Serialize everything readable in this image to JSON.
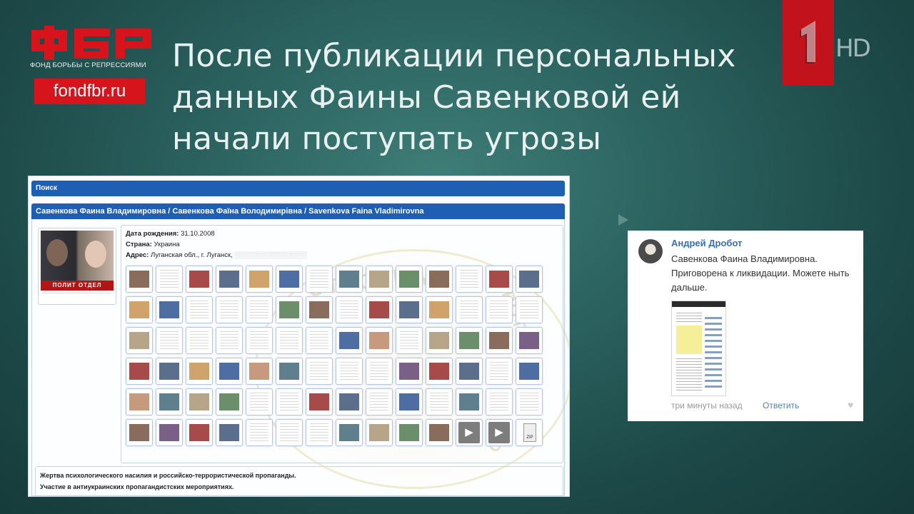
{
  "logo": {
    "wordmark": "ФБР",
    "subtitle": "ФОНД БОРЬБЫ С РЕПРЕССИЯМИ",
    "site": "fondfbr.ru",
    "brand_color": "#d7141b"
  },
  "channel": {
    "logo_digit": "1",
    "hd": "HD",
    "badge_color": "#c2121c"
  },
  "headline": "После публикации персональных данных Фаины Савенковой ей начали поступать угрозы",
  "screenshot": {
    "search_label": "Поиск",
    "person_title": "Савенкова Фаина Владимировна / Савенкова Фаїна Володимирівна / Savenkova Faina Vladimirovna",
    "photo_banner": "ПОЛИТ ОТДЕЛ",
    "birth_label": "Дата рождения:",
    "birth_value": "31.10.2008",
    "country_label": "Страна:",
    "country_value": "Украина",
    "address_label": "Адрес:",
    "address_value": "Луганская обл., г. Луганск,",
    "watermark": "МИРОТВОРЕЦ",
    "description_line1": "Жертва психологического насилия и российско-террористической пропаганды.",
    "description_line2": "Участие в антиукраинских пропагандистских мероприятиях.",
    "accent_color": "#1f5fb3"
  },
  "comment": {
    "author": "Андрей Дробот",
    "text": "Савенкова Фаина Владимировна. Приговорена к ликвидации. Можете ныть дальше.",
    "time": "три минуты назад",
    "reply_label": "Ответить",
    "like_icon": "heart-icon"
  }
}
